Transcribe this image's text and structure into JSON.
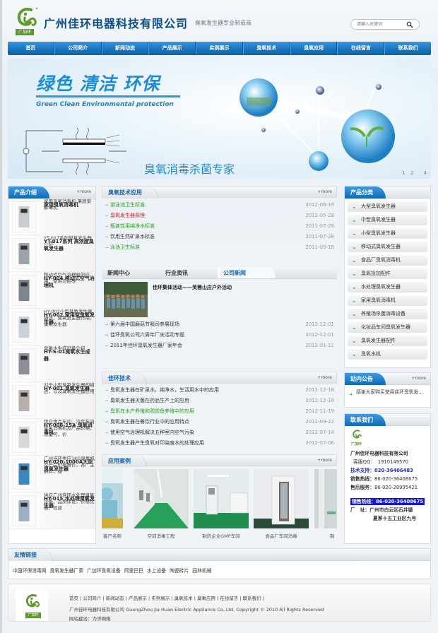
{
  "header": {
    "logo_badge": "广加环",
    "company_name": "广州佳环电器科技有限公司",
    "slogan": "臭氧发生器专业制造商",
    "search_placeholder": "请输入关键词"
  },
  "nav": [
    "首页",
    "公司简介",
    "新闻动态",
    "产品展示",
    "实例展示",
    "臭氧技术",
    "臭氧应用",
    "在线留言",
    "联系我们"
  ],
  "banner": {
    "title": "绿色 清洁 环保",
    "subtitle": "Green Clean Environmental protection",
    "slogan": "臭氧消毒杀菌专家",
    "pager": [
      "1",
      "2",
      "4"
    ]
  },
  "products": {
    "title": "产品介绍",
    "more": "+more",
    "items": [
      {
        "title": "家用臭氧消毒机",
        "desc": "家用臭氧消毒机 果蔬菜解毒机"
      },
      {
        "title": "YT-017系列 高浓度臭氧发生器",
        "desc": "YT-017系列臭氧发生器介绍"
      },
      {
        "title": "HY-004 移动式空气治理机",
        "desc": "移动式空气治理机的应用，使用范围等"
      },
      {
        "title": "HY-002 家用型臭氧发生器",
        "desc": "HY-002小型臭氧发生器描述，臭氧发生器作用，臭氧发生器"
      },
      {
        "title": "HY-S-01臭氧水生成器",
        "desc": "臭氧水生成设备介绍"
      },
      {
        "title": "HY-001 臭氧发生器",
        "desc": "对于小型臭氧发生器的描述，以及臭氧发生器应用"
      },
      {
        "title": "HY-006-15A 臭氧消毒机",
        "desc": "供应食品车间、冷库车间臭氧消毒机及产品价格，质量可，价"
      },
      {
        "title": "HY-020-1000A大型臭氧发生器",
        "desc": "广州佳环供应1KG臭氧机及产品价格报价，各厂主品牌，品"
      },
      {
        "title": "HY-015 水处理臭氧发生器",
        "desc": "供应广州佳环水处理臭氧设备，品质保证，价格优惠，欢迎"
      }
    ]
  },
  "tech": {
    "title": "臭氧技术应用",
    "more": "+more",
    "items": [
      {
        "text": "游泳池卫生标准",
        "date": "2012-06-19",
        "color": "green"
      },
      {
        "text": "臭氧发生器原理",
        "date": "2012-05-28",
        "color": "red"
      },
      {
        "text": "瓶装饮用纯净水标准",
        "date": "2011-07-28",
        "color": "green"
      },
      {
        "text": "饮用生然矿泉水标准",
        "date": "2011-07-28",
        "color": "dark"
      },
      {
        "text": "泳池卫生标准",
        "date": "2011-05-18",
        "color": "green"
      }
    ]
  },
  "news": {
    "tabs": [
      "新闻中心",
      "行业资讯",
      "公司新闻"
    ],
    "active_tab": 2,
    "featured": "佳环集体活动——芙蓉山庄户外活动",
    "items": [
      {
        "text": "第六届中国磨菇节我司参展现场",
        "date": "2012-12-01"
      },
      {
        "text": "佳环臭氧公司六周年厂庆活动专题",
        "date": "2012-12-01"
      },
      {
        "text": "2011年佳环臭氧发生器厂家年会",
        "date": "2012-01-11"
      }
    ]
  },
  "jiahuan_tech": {
    "title": "佳环技术",
    "more": "+more",
    "items": [
      {
        "text": "臭氧发生器在矿泉水，纯净水，生活用水中的应用",
        "date": "2012-12-18",
        "color": "dark"
      },
      {
        "text": "臭氧发生器灭菌在药品生产上的应用",
        "date": "2012-12-18",
        "color": "dark"
      },
      {
        "text": "臭氧在水产养殖和观赏鱼养殖中的应用",
        "date": "2012-11-19",
        "color": "green"
      },
      {
        "text": "臭氧发生器在餐饮行业中的应用特点",
        "date": "2012-09-22",
        "color": "dark"
      },
      {
        "text": "使用空气治理机解决五种室内空气污染",
        "date": "2012-07-14",
        "color": "dark"
      },
      {
        "text": "臭氧发生器产生臭氧对印染废水的处理应用",
        "date": "2012-07-06",
        "color": "dark"
      }
    ]
  },
  "cases": {
    "title": "应用案例",
    "more": "+more",
    "items": [
      "客户名称",
      "空间消毒工程",
      "制药企业GMP车间",
      "食品厂车间消毒",
      "制"
    ]
  },
  "categories": {
    "title": "产品分类",
    "items": [
      "大型臭氧发生器",
      "中型臭氧发生器",
      "小型臭氧发生器",
      "移动式臭氧发生器",
      "食品厂臭氧消毒机",
      "臭氧投加配件",
      "水处理臭氧发生器",
      "家用臭氧消毒机",
      "养殖场杀菌消毒设备",
      "化妆品车间臭氧发生器",
      "臭氧发生器配件",
      "臭氧水机"
    ]
  },
  "notice": {
    "title": "站内公告",
    "more": "+more",
    "text": "感谢大家购买使用佳环臭氧发..."
  },
  "contact": {
    "title": "联系我们",
    "logo_text": "广加环",
    "company": "广州佳环电器科技有限公司",
    "qq_label": "客服QQ:",
    "qq": "1910149570",
    "tech_label": "技术支持：",
    "tech": "020-36406483",
    "sales_label": "销售热线：",
    "sales": "86-020-36408675",
    "after_label": "售后服务：",
    "after": "86-020-28995421",
    "hot_label": "销售热线：",
    "hot": "86-020-36408675",
    "addr_label": "厂　址：",
    "addr1": "广州市白云区石井镇",
    "addr2": "夏茅十五工业区九号"
  },
  "links": {
    "title": "友情链接",
    "items": [
      "中国环保消毒网",
      "臭氧发生器厂家",
      "广加环臭氧设备",
      "阿里巴巴",
      "水上设备",
      "陶瓷砖片",
      "园林机械"
    ]
  },
  "footer": {
    "nav": [
      "首页",
      "公司简介",
      "新闻动态",
      "产品展示",
      "实例展示",
      "臭氧技术",
      "臭氧应用",
      "在线留言",
      "联系我们"
    ],
    "copyright": "广州佳环电器科技有限公司 GuangZhou Jia Huan Electric Appliance Co.,Ltd. Copyright © 2010 All Rights Reserved",
    "builder": "网站建设：力洋网络",
    "logo_badge": "广加环"
  },
  "colors": {
    "brand_blue": "#1a78c2",
    "logo_green": "#5b9a27",
    "link_green": "#2a9a1e",
    "link_red": "#e0181e"
  }
}
